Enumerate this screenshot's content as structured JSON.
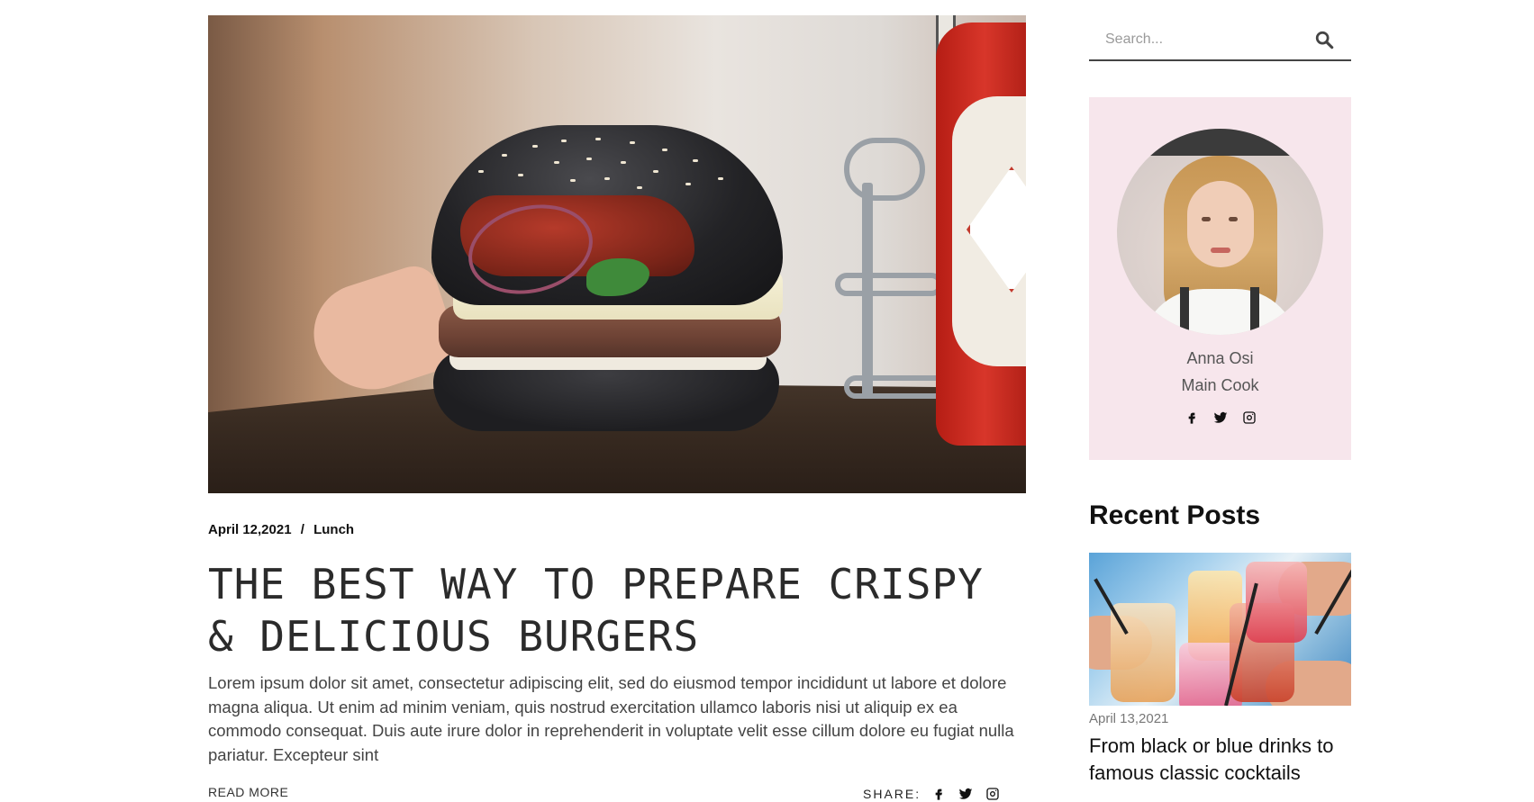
{
  "post": {
    "date": "April 12,2021",
    "separator": "/",
    "category": "Lunch",
    "title": "THE BEST WAY TO PREPARE CRISPY & DELICIOUS BURGERS",
    "excerpt": "Lorem ipsum dolor sit amet, consectetur adipiscing elit, sed do eiusmod tempor incididunt ut labore et dolore magna aliqua. Ut enim ad minim veniam, quis nostrud exercitation ullamco laboris nisi ut aliquip ex ea commodo consequat. Duis aute irure dolor in reprehenderit in voluptate velit esse cillum dolore eu fugiat nulla pariatur. Excepteur sint",
    "read_more": "READ MORE",
    "share_label": "SHARE:",
    "share_icons": [
      "facebook-icon",
      "twitter-icon",
      "instagram-icon"
    ]
  },
  "sidebar": {
    "search": {
      "placeholder": "Search...",
      "value": "",
      "icon": "search-icon"
    },
    "author": {
      "name": "Anna Osi",
      "role": "Main Cook",
      "social_icons": [
        "facebook-icon",
        "twitter-icon",
        "instagram-icon"
      ]
    },
    "recent_posts": {
      "heading": "Recent Posts",
      "items": [
        {
          "date": "April 13,2021",
          "title": "From black or blue drinks to famous classic cocktails"
        }
      ]
    }
  },
  "colors": {
    "author_card_bg": "#f7e6ec",
    "text_dark": "#111111",
    "text_muted": "#777777"
  }
}
